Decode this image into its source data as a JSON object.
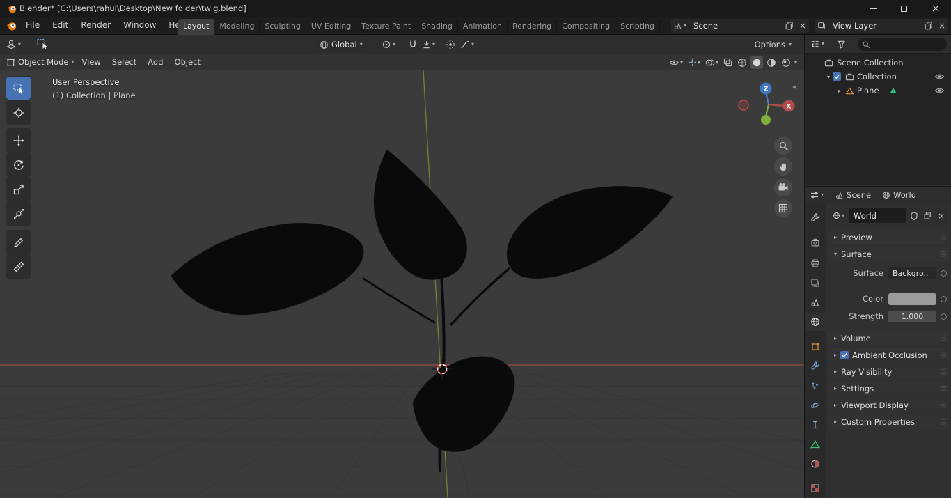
{
  "colors": {
    "accent": "#4772b3",
    "object_orange": "#e0913c",
    "mesh_green": "#2ec27e",
    "axis_x_red": "#a04848",
    "axis_y_green": "#70802e",
    "viewport_bg": "#3b3b3b",
    "color_swatch": "#9b9b9b"
  },
  "icons": {
    "down_arrow": "▾",
    "right_tri": "▸",
    "down_tri": "▾",
    "close": "×",
    "plus": "+",
    "grip": "⣿⣿",
    "collapse_left": "◂"
  },
  "titlebar": {
    "title": "Blender* [C:\\Users\\rahul\\Desktop\\New folder\\twig.blend]"
  },
  "topbar": {
    "menus": [
      {
        "label": "File"
      },
      {
        "label": "Edit"
      },
      {
        "label": "Render"
      },
      {
        "label": "Window"
      },
      {
        "label": "Help"
      }
    ],
    "workspaces": [
      {
        "label": "Layout"
      },
      {
        "label": "Modeling"
      },
      {
        "label": "Sculpting"
      },
      {
        "label": "UV Editing"
      },
      {
        "label": "Texture Paint"
      },
      {
        "label": "Shading"
      },
      {
        "label": "Animation"
      },
      {
        "label": "Rendering"
      },
      {
        "label": "Compositing"
      },
      {
        "label": "Scripting"
      }
    ],
    "scene_name": "Scene",
    "view_layer_name": "View Layer"
  },
  "tool_settings": {
    "orientation": "Global",
    "options": "Options"
  },
  "viewport": {
    "mode": "Object Mode",
    "menus": [
      {
        "label": "View"
      },
      {
        "label": "Select"
      },
      {
        "label": "Add"
      },
      {
        "label": "Object"
      }
    ],
    "overlay_perspective": "User Perspective",
    "overlay_context": "(1) Collection | Plane",
    "gizmo": {
      "z": "Z",
      "x": "X"
    }
  },
  "outliner": {
    "rows": [
      {
        "label": "Scene Collection"
      },
      {
        "label": "Collection"
      },
      {
        "label": "Plane"
      }
    ]
  },
  "properties": {
    "breadcrumb": {
      "scene": "Scene",
      "world": "World"
    },
    "world_name": "World",
    "panels": {
      "preview": "Preview",
      "surface": "Surface",
      "volume": "Volume",
      "ambient_occlusion": "Ambient Occlusion",
      "ray_visibility": "Ray Visibility",
      "settings": "Settings",
      "viewport_display": "Viewport Display",
      "custom_properties": "Custom Properties"
    },
    "surface_rows": {
      "surface_label": "Surface",
      "surface_value": "Backgro..",
      "color_label": "Color",
      "strength_label": "Strength",
      "strength_value": "1.000"
    }
  }
}
